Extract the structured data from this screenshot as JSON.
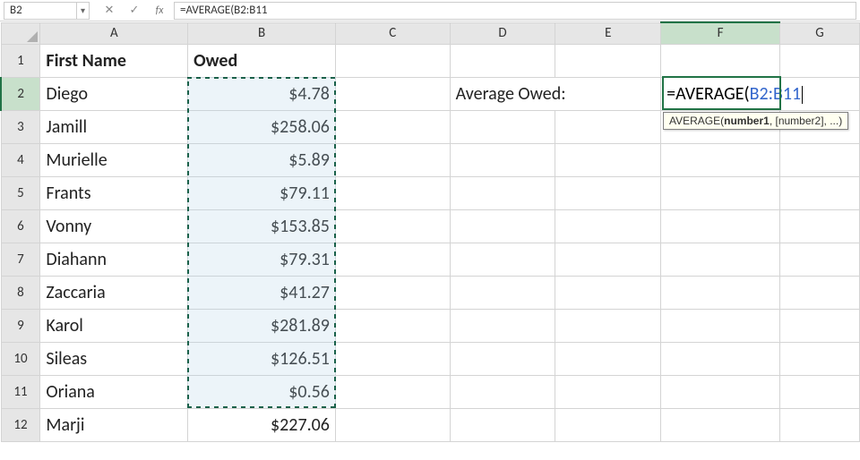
{
  "namebox": {
    "value": "B2"
  },
  "formula_bar": {
    "value": "=AVERAGE(B2:B11"
  },
  "column_headers": [
    "A",
    "B",
    "C",
    "D",
    "E",
    "F",
    "G"
  ],
  "row_headers": [
    "1",
    "2",
    "3",
    "4",
    "5",
    "6",
    "7",
    "8",
    "9",
    "10",
    "11",
    "12"
  ],
  "headers": {
    "A": "First Name",
    "B": "Owed"
  },
  "d2_label": "Average Owed:",
  "f2_editing": {
    "prefix": "=AVERAGE(",
    "ref": "B2:B11"
  },
  "tooltip": {
    "func": "AVERAGE",
    "arg_bold": "number1",
    "rest": ", [number2], ...)"
  },
  "chart_data": {
    "type": "table",
    "columns": [
      "First Name",
      "Owed"
    ],
    "rows": [
      [
        "Diego",
        4.78
      ],
      [
        "Jamill",
        258.06
      ],
      [
        "Murielle",
        5.89
      ],
      [
        "Frants",
        79.11
      ],
      [
        "Vonny",
        153.85
      ],
      [
        "Diahann",
        79.31
      ],
      [
        "Zaccaria",
        41.27
      ],
      [
        "Karol",
        281.89
      ],
      [
        "Sileas",
        126.51
      ],
      [
        "Oriana",
        0.56
      ],
      [
        "Marji",
        227.06
      ]
    ]
  },
  "data": {
    "A": [
      "Diego",
      "Jamill",
      "Murielle",
      "Frants",
      "Vonny",
      "Diahann",
      "Zaccaria",
      "Karol",
      "Sileas",
      "Oriana",
      "Marji"
    ],
    "B": [
      "$4.78",
      "$258.06",
      "$5.89",
      "$79.11",
      "$153.85",
      "$79.31",
      "$41.27",
      "$281.89",
      "$126.51",
      "$0.56",
      "$227.06"
    ]
  }
}
